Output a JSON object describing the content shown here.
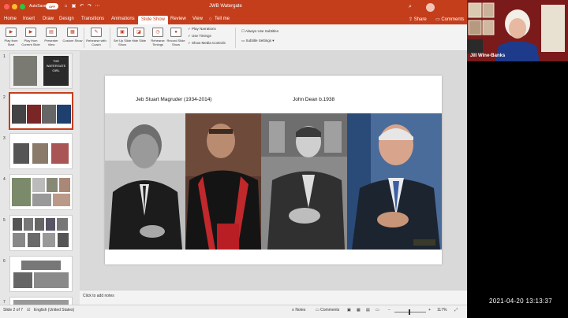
{
  "titlebar": {
    "autosave_label": "AutoSave",
    "autosave_state": "OFF",
    "document_title": "JWB Watergate",
    "search_icon": "search-icon",
    "colors": {
      "brand": "#c43e1c",
      "close": "#ff5f57",
      "minimize": "#febc2e",
      "maximize": "#28c840"
    }
  },
  "menu": {
    "items": [
      "Home",
      "Insert",
      "Draw",
      "Design",
      "Transitions",
      "Animations",
      "Slide Show",
      "Review",
      "View"
    ],
    "active": "Slide Show",
    "tell_me": "Tell me",
    "share": "Share",
    "comments": "Comments"
  },
  "ribbon": {
    "buttons": [
      "Play from Start",
      "Play from Current Slide",
      "Presenter View",
      "Custom Show",
      "Rehearse with Coach",
      "Set Up Slide Show",
      "Hide Slide",
      "Rehearse Timings",
      "Record Slide Show"
    ],
    "checks": [
      "Play Narrations",
      "Use Timings",
      "Show Media Controls"
    ],
    "always_subtitles": "Always Use Subtitles",
    "subtitle_settings": "Subtitle Settings"
  },
  "slide": {
    "left_title": "Jeb Stuart Magruder (1934-2014)",
    "right_title": "John Dean  b.1938"
  },
  "thumbnails": {
    "numbers": [
      "1",
      "2",
      "3",
      "4",
      "5",
      "6",
      "7"
    ],
    "selected": "2",
    "slide1_text": "THE WATERGATE GIRL"
  },
  "notes": {
    "placeholder": "Click to add notes"
  },
  "status": {
    "slide_counter": "Slide 2 of 7",
    "language": "English (United States)",
    "notes_btn": "Notes",
    "comments_btn": "Comments",
    "zoom": "117%"
  },
  "video": {
    "name": "Jill Wine-Banks"
  },
  "timestamp": "2021-04-20  13:13:37"
}
